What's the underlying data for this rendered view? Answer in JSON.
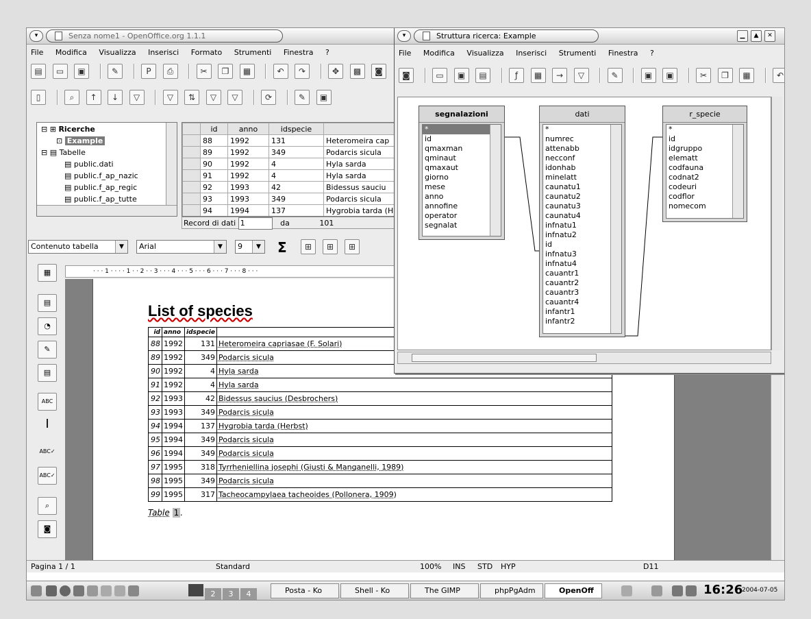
{
  "main_window": {
    "title": "Senza nome1 - OpenOffice.org 1.1.1",
    "menu": [
      "File",
      "Modifica",
      "Visualizza",
      "Inserisci",
      "Formato",
      "Strumenti",
      "Finestra",
      "?"
    ],
    "tree": {
      "ricerche": "Ricerche",
      "example": "Example",
      "tabelle": "Tabelle",
      "items": [
        "public.dati",
        "public.f_ap_nazic",
        "public.f_ap_regic",
        "public.f_ap_tutte"
      ]
    },
    "grid": {
      "headers": [
        "id",
        "anno",
        "idspecie",
        ""
      ],
      "rows": [
        [
          "88",
          "1992",
          "131",
          "Heteromeira cap"
        ],
        [
          "89",
          "1992",
          "349",
          "Podarcis sicula"
        ],
        [
          "90",
          "1992",
          "4",
          "Hyla sarda"
        ],
        [
          "91",
          "1992",
          "4",
          "Hyla sarda"
        ],
        [
          "92",
          "1993",
          "42",
          "Bidessus sauciu"
        ],
        [
          "93",
          "1993",
          "349",
          "Podarcis sicula"
        ],
        [
          "94",
          "1994",
          "137",
          "Hygrobia tarda (H"
        ]
      ],
      "record_label": "Record di dati",
      "record_value": "1",
      "record_of": "da",
      "record_total": "101"
    },
    "format_bar": {
      "style": "Contenuto tabella",
      "font": "Arial",
      "size": "9",
      "sigma": "Σ"
    },
    "ruler_marks": "· · · 1 · · ·   · 1 · · 2 · · 3 · · · 4 · · · 5 · · · 6 · · · 7 · · · 8 · · ·"
  },
  "document": {
    "heading": "List of species",
    "col_headers": [
      "id",
      "anno",
      "idspecie",
      ""
    ],
    "rows": [
      [
        "88",
        "1992",
        "131",
        "Heteromeira capriasae (F. Solari)"
      ],
      [
        "89",
        "1992",
        "349",
        "Podarcis sicula"
      ],
      [
        "90",
        "1992",
        "4",
        "Hyla sarda"
      ],
      [
        "91",
        "1992",
        "4",
        "Hyla sarda"
      ],
      [
        "92",
        "1993",
        "42",
        "Bidessus saucius (Desbrochers)"
      ],
      [
        "93",
        "1993",
        "349",
        "Podarcis sicula"
      ],
      [
        "94",
        "1994",
        "137",
        "Hygrobia tarda (Herbst)"
      ],
      [
        "95",
        "1994",
        "349",
        "Podarcis sicula"
      ],
      [
        "96",
        "1994",
        "349",
        "Podarcis sicula"
      ],
      [
        "97",
        "1995",
        "318",
        "Tyrrheniellina josephi (Giusti & Manganelli, 1989)"
      ],
      [
        "98",
        "1995",
        "349",
        "Podarcis sicula"
      ],
      [
        "99",
        "1995",
        "317",
        "Tacheocampylaea tacheoides (Pollonera, 1909)"
      ]
    ],
    "caption_label": "Table",
    "caption_num": "1",
    "caption_dot": "."
  },
  "status_bar": {
    "page": "Pagina 1 / 1",
    "style": "Standard",
    "zoom": "100%",
    "ins": "INS",
    "std": "STD",
    "hyp": "HYP",
    "cell": "D11"
  },
  "query_window": {
    "title": "Struttura ricerca: Example",
    "menu": [
      "File",
      "Modifica",
      "Visualizza",
      "Inserisci",
      "Strumenti",
      "Finestra",
      "?"
    ],
    "tables": [
      {
        "name": "segnalazioni",
        "fields": [
          "*",
          "id",
          "qmaxman",
          "qminaut",
          "qmaxaut",
          "giorno",
          "mese",
          "anno",
          "annofine",
          "operator",
          "segnalat"
        ]
      },
      {
        "name": "dati",
        "fields": [
          "*",
          "numrec",
          "attenabb",
          "necconf",
          "idonhab",
          "minelatt",
          "caunatu1",
          "caunatu2",
          "caunatu3",
          "caunatu4",
          "infnatu1",
          "infnatu2",
          "id",
          "infnatu3",
          "infnatu4",
          "cauantr1",
          "cauantr2",
          "cauantr3",
          "cauantr4",
          "infantr1",
          "infantr2"
        ]
      },
      {
        "name": "r_specie",
        "fields": [
          "*",
          "id",
          "idgruppo",
          "elematt",
          "codfauna",
          "codnat2",
          "codeuri",
          "codflor",
          "nomecom"
        ]
      }
    ]
  },
  "taskbar": {
    "desktops": [
      "2",
      "3",
      "4"
    ],
    "tasks": [
      "Posta - Ko",
      "Shell - Ko",
      "The GIMP",
      "phpPgAdm",
      "OpenOff"
    ],
    "clock": "16:26",
    "date": "2004-07-05"
  },
  "colors": {
    "accent_blue": "#0a246a",
    "selection": "#1e3c8a",
    "desktop": "#e0e0e0"
  }
}
